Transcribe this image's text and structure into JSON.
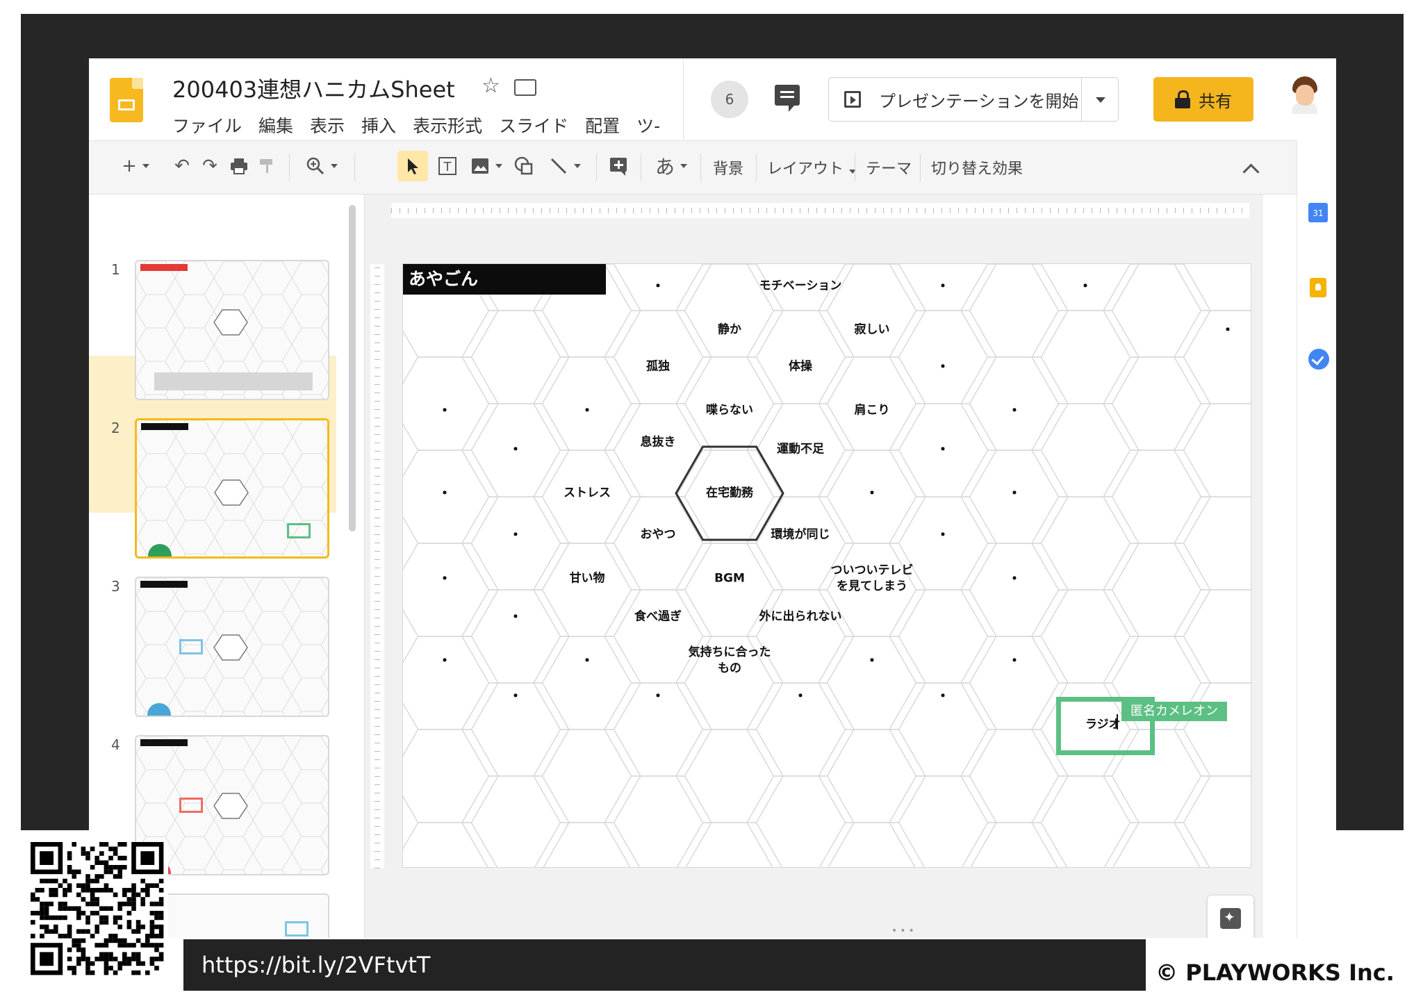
{
  "header": {
    "doc_title": "200403連想ハニカムSheet",
    "star_icon": "☆",
    "menu": [
      "ファイル",
      "編集",
      "表示",
      "挿入",
      "表示形式",
      "スライド",
      "配置",
      "ツ-"
    ],
    "collaborator_count": "6",
    "present_label": "プレゼンテーションを開始",
    "share_label": "共有"
  },
  "toolbar": {
    "add": "+",
    "undo": "↶",
    "redo": "↷",
    "input_tool": "あ",
    "background": "背景",
    "layout": "レイアウト",
    "theme": "テーマ",
    "transition": "切り替え効果"
  },
  "filmstrip": {
    "slides": [
      {
        "num": "1",
        "selected": false
      },
      {
        "num": "2",
        "selected": true
      },
      {
        "num": "3",
        "selected": false
      },
      {
        "num": "4",
        "selected": false
      }
    ]
  },
  "slide": {
    "label": "あやごん",
    "cells": [
      {
        "text": "・"
      },
      {
        "text": "・"
      },
      {
        "text": "・"
      },
      {
        "text": "・"
      },
      {
        "text": "・"
      },
      {
        "text": "モチベーション"
      },
      {
        "text": "・"
      },
      {
        "text": "・"
      },
      {
        "text": "静か"
      },
      {
        "text": "寂しい"
      },
      {
        "text": "孤独"
      },
      {
        "text": "体操"
      },
      {
        "text": "・"
      },
      {
        "text": "・"
      },
      {
        "text": "・"
      },
      {
        "text": "・"
      },
      {
        "text": "喋らない"
      },
      {
        "text": "肩こり"
      },
      {
        "text": "・"
      },
      {
        "text": "・"
      },
      {
        "text": "息抜き"
      },
      {
        "text": "運動不足"
      },
      {
        "text": "・"
      },
      {
        "text": "・"
      },
      {
        "text": "ストレス"
      },
      {
        "text": "在宅勤務"
      },
      {
        "text": "・"
      },
      {
        "text": "・"
      },
      {
        "text": "・"
      },
      {
        "text": "おやつ"
      },
      {
        "text": "環境が同じ"
      },
      {
        "text": "・"
      },
      {
        "text": "・"
      },
      {
        "text": "甘い物"
      },
      {
        "text": "BGM"
      },
      {
        "text": "ついついテレビを見てしまう"
      },
      {
        "text": "・"
      },
      {
        "text": "・"
      },
      {
        "text": "食べ過ぎ"
      },
      {
        "text": "外に出られない"
      },
      {
        "text": "・"
      },
      {
        "text": "・"
      },
      {
        "text": "気持ちに合ったもの"
      },
      {
        "text": "・"
      },
      {
        "text": "・"
      },
      {
        "text": "・"
      },
      {
        "text": "・"
      },
      {
        "text": "・"
      },
      {
        "text": "・"
      }
    ],
    "selected_cell_text": "ラジオ",
    "cursor_user": "匿名カメレオン"
  },
  "overlay": {
    "url": "https://bit.ly/2VFtvtT",
    "copyright": "© PLAYWORKS Inc."
  },
  "colors": {
    "brand_yellow": "#f5b51d",
    "selection_green": "#5cbf83"
  }
}
